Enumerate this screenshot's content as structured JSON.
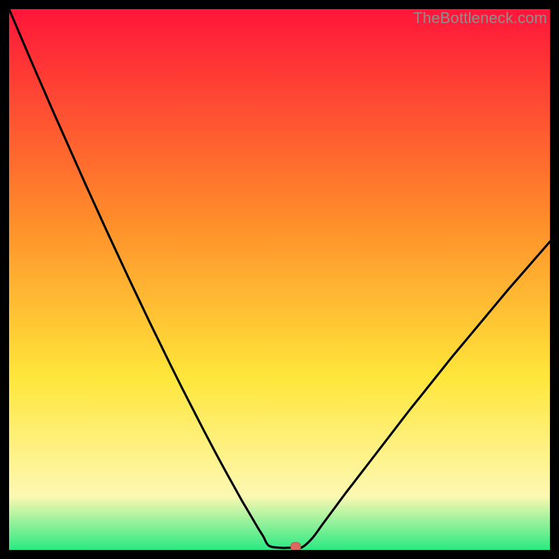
{
  "watermark": "TheBottleneck.com",
  "colors": {
    "bg": "#000000",
    "grad_top": "#ff153a",
    "grad_mid1": "#ff8a2a",
    "grad_mid2": "#ffe63a",
    "grad_mid3": "#fdf8b2",
    "grad_bottom": "#2aea83",
    "curve": "#000000",
    "marker_fill": "#d86a5e",
    "marker_stroke": "#bb5a4e"
  },
  "chart_data": {
    "type": "line",
    "title": "",
    "xlabel": "",
    "ylabel": "",
    "xlim": [
      0,
      100
    ],
    "ylim": [
      0,
      100
    ],
    "x": [
      0,
      2,
      4,
      6,
      8,
      10,
      12,
      14,
      16,
      18,
      20,
      22,
      24,
      26,
      28,
      30,
      32,
      34,
      36,
      38,
      40,
      41,
      42,
      43,
      44,
      45,
      46,
      47,
      48,
      50,
      52,
      54,
      56,
      58,
      60,
      62,
      64,
      66,
      68,
      70,
      72,
      74,
      76,
      78,
      80,
      82,
      84,
      86,
      88,
      90,
      92,
      94,
      96,
      98,
      100
    ],
    "values": [
      100,
      95.3,
      90.6,
      86.0,
      81.4,
      76.9,
      72.4,
      67.9,
      63.5,
      59.1,
      54.8,
      50.5,
      46.3,
      42.1,
      38.0,
      33.9,
      29.9,
      26.0,
      22.1,
      18.3,
      14.6,
      12.8,
      11.0,
      9.2,
      7.5,
      5.8,
      4.1,
      2.5,
      0.8,
      0.4,
      0.4,
      0.4,
      2.1,
      4.8,
      7.5,
      10.2,
      12.8,
      15.4,
      18.0,
      20.6,
      23.2,
      25.8,
      28.3,
      30.8,
      33.3,
      35.8,
      38.2,
      40.6,
      43.0,
      45.4,
      47.8,
      50.1,
      52.4,
      54.7,
      57.0
    ],
    "marker": {
      "x": 53,
      "y": 0.6
    },
    "flat_segment": {
      "x0": 48,
      "x1": 53,
      "y": 0.4
    }
  }
}
